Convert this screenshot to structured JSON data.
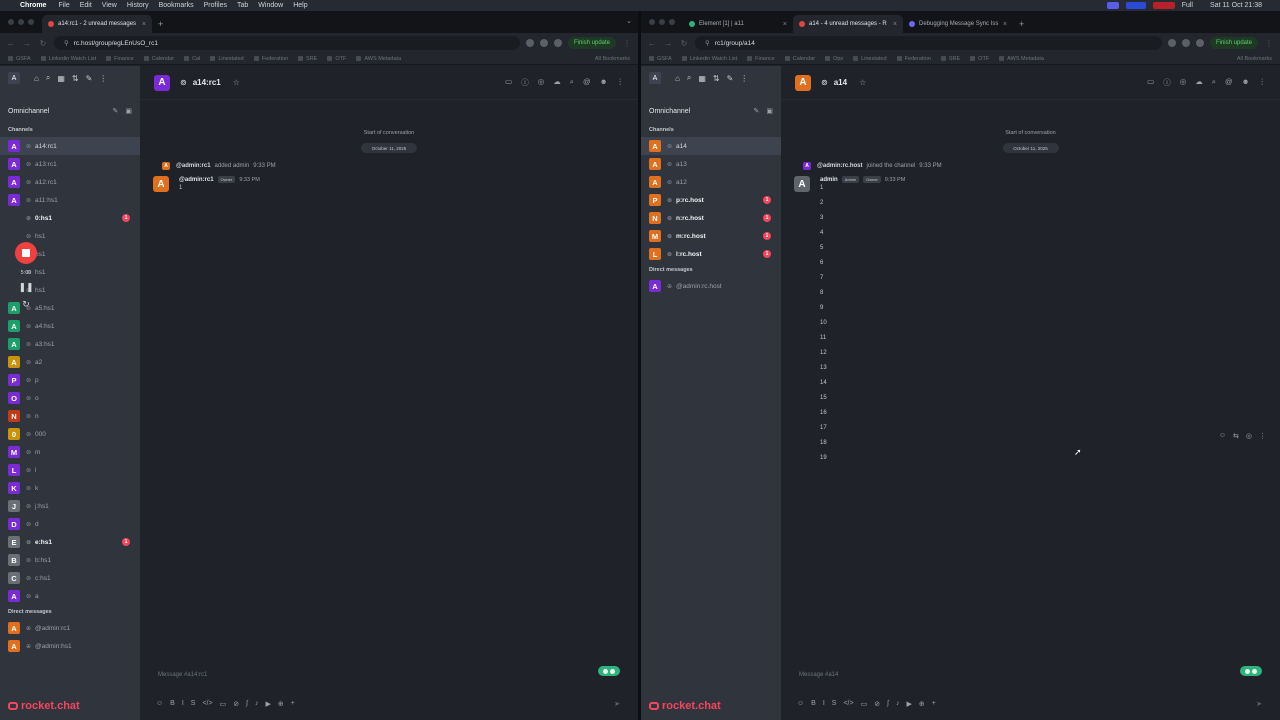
{
  "menubar": {
    "apple": "",
    "app": "Chrome",
    "items": [
      "File",
      "Edit",
      "View",
      "History",
      "Bookmarks",
      "Profiles",
      "Tab",
      "Window",
      "Help"
    ],
    "battery": "Full",
    "clock": "Sat 11 Oct  21:38"
  },
  "left": {
    "tabs": [
      {
        "label": "a14:rc1 - 2 unread messages",
        "active": true
      }
    ],
    "url": "rc.host/group/egLEnUsO_rc1",
    "update_label": "Finish update",
    "bookmarks": [
      "GSFA",
      "Linkedin Watch List",
      "Finance",
      "Calendar",
      "Cal",
      "Linestated",
      "Federation",
      "SRE",
      "OTF",
      "AWS Metadata"
    ],
    "all_bookmarks": "All Bookmarks",
    "sidebar": {
      "me_initial": "A",
      "omnichannel": "Omnichannel",
      "channels_header": "Channels",
      "dm_header": "Direct messages",
      "channels": [
        {
          "initial": "A",
          "color": "#7a2bd6",
          "name": "a14:rc1",
          "selected": true,
          "unread": false,
          "badge": ""
        },
        {
          "initial": "A",
          "color": "#7a2bd6",
          "name": "a13:rc1",
          "selected": false,
          "unread": false,
          "badge": ""
        },
        {
          "initial": "A",
          "color": "#7a2bd6",
          "name": "a12:rc1",
          "selected": false,
          "unread": false,
          "badge": ""
        },
        {
          "initial": "A",
          "color": "#7a2bd6",
          "name": "a11:hs1",
          "selected": false,
          "unread": false,
          "badge": ""
        },
        {
          "initial": "",
          "color": "#2f343d",
          "name": "0:hs1",
          "selected": false,
          "unread": true,
          "badge": "1"
        },
        {
          "initial": "",
          "color": "#2f343d",
          "name": "hs1",
          "selected": false,
          "unread": false,
          "badge": ""
        },
        {
          "initial": "",
          "color": "#2f343d",
          "name": "hs1",
          "selected": false,
          "unread": false,
          "badge": ""
        },
        {
          "initial": "",
          "color": "#2f343d",
          "name": "hs1",
          "selected": false,
          "unread": false,
          "badge": ""
        },
        {
          "initial": "",
          "color": "#2f343d",
          "name": "hs1",
          "selected": false,
          "unread": false,
          "badge": ""
        },
        {
          "initial": "A",
          "color": "#1d9f6c",
          "name": "a5:hs1",
          "selected": false,
          "unread": false,
          "badge": ""
        },
        {
          "initial": "A",
          "color": "#1d9f6c",
          "name": "a4:hs1",
          "selected": false,
          "unread": false,
          "badge": ""
        },
        {
          "initial": "A",
          "color": "#1d9f6c",
          "name": "a3:hs1",
          "selected": false,
          "unread": false,
          "badge": ""
        },
        {
          "initial": "A",
          "color": "#c9940b",
          "name": "a2",
          "selected": false,
          "unread": false,
          "badge": ""
        },
        {
          "initial": "P",
          "color": "#7a2bd6",
          "name": "p",
          "selected": false,
          "unread": false,
          "badge": ""
        },
        {
          "initial": "O",
          "color": "#7a2bd6",
          "name": "o",
          "selected": false,
          "unread": false,
          "badge": ""
        },
        {
          "initial": "N",
          "color": "#c23a16",
          "name": "n",
          "selected": false,
          "unread": false,
          "badge": ""
        },
        {
          "initial": "0",
          "color": "#c9940b",
          "name": "000",
          "selected": false,
          "unread": false,
          "badge": ""
        },
        {
          "initial": "M",
          "color": "#7a2bd6",
          "name": "m",
          "selected": false,
          "unread": false,
          "badge": ""
        },
        {
          "initial": "L",
          "color": "#7a2bd6",
          "name": "l",
          "selected": false,
          "unread": false,
          "badge": ""
        },
        {
          "initial": "K",
          "color": "#7a2bd6",
          "name": "k",
          "selected": false,
          "unread": false,
          "badge": ""
        },
        {
          "initial": "J",
          "color": "#6b6f76",
          "name": "j:hs1",
          "selected": false,
          "unread": false,
          "badge": ""
        },
        {
          "initial": "D",
          "color": "#7a2bd6",
          "name": "d",
          "selected": false,
          "unread": false,
          "badge": ""
        },
        {
          "initial": "E",
          "color": "#6b6f76",
          "name": "e:hs1",
          "selected": false,
          "unread": true,
          "badge": "1"
        },
        {
          "initial": "B",
          "color": "#6b6f76",
          "name": "b:hs1",
          "selected": false,
          "unread": false,
          "badge": ""
        },
        {
          "initial": "C",
          "color": "#6b6f76",
          "name": "c:hs1",
          "selected": false,
          "unread": false,
          "badge": ""
        },
        {
          "initial": "A",
          "color": "#7a2bd6",
          "name": "a",
          "selected": false,
          "unread": false,
          "badge": ""
        }
      ],
      "dms": [
        {
          "initial": "A",
          "color": "#e0701e",
          "name": "@admin:rc1"
        },
        {
          "initial": "A",
          "color": "#e0701e",
          "name": "@admin:hs1"
        }
      ],
      "logo": "rocket.chat"
    },
    "recorder": {
      "time": "5:00"
    },
    "room": {
      "initial": "A",
      "color": "#7a2bd6",
      "title": "a14:rc1",
      "start": "Start of conversation",
      "date": "October 11, 2025",
      "system": {
        "initial": "A",
        "color": "#e0701e",
        "user": "@admin:rc1",
        "text": "added admin",
        "time": "9:33 PM"
      },
      "messages": [
        {
          "initial": "A",
          "color": "#e0701e",
          "user": "@admin:rc1",
          "role": "Owner",
          "time": "9:33 PM",
          "lines": [
            "1"
          ]
        }
      ],
      "composer_placeholder": "Message #a14:rc1"
    }
  },
  "right": {
    "tabs": [
      {
        "label": "Element [1] | a11",
        "active": false,
        "fav": "g"
      },
      {
        "label": "a14 - 4 unread messages - R",
        "active": true,
        "fav": "r"
      },
      {
        "label": "Debugging Message Sync Iss",
        "active": false,
        "fav": "p"
      }
    ],
    "url": "rc1/group/a14",
    "update_label": "Finish update",
    "bookmarks": [
      "GSFA",
      "Linkedin Watch List",
      "Finance",
      "Calendar",
      "Ops",
      "Linestated",
      "Federation",
      "SRE",
      "OTF",
      "AWS Metadata"
    ],
    "all_bookmarks": "All Bookmarks",
    "sidebar": {
      "me_initial": "A",
      "omnichannel": "Omnichannel",
      "channels_header": "Channels",
      "dm_header": "Direct messages",
      "channels": [
        {
          "initial": "A",
          "color": "#e0701e",
          "name": "a14",
          "selected": true,
          "unread": false,
          "badge": ""
        },
        {
          "initial": "A",
          "color": "#e0701e",
          "name": "a13",
          "selected": false,
          "unread": false,
          "badge": ""
        },
        {
          "initial": "A",
          "color": "#e0701e",
          "name": "a12",
          "selected": false,
          "unread": false,
          "badge": ""
        },
        {
          "initial": "P",
          "color": "#e0701e",
          "name": "p:rc.host",
          "selected": false,
          "unread": true,
          "badge": "1"
        },
        {
          "initial": "N",
          "color": "#e0701e",
          "name": "n:rc.host",
          "selected": false,
          "unread": true,
          "badge": "1"
        },
        {
          "initial": "M",
          "color": "#e0701e",
          "name": "m:rc.host",
          "selected": false,
          "unread": true,
          "badge": "1"
        },
        {
          "initial": "L",
          "color": "#e0701e",
          "name": "l:rc.host",
          "selected": false,
          "unread": true,
          "badge": "1"
        }
      ],
      "dms": [
        {
          "initial": "A",
          "color": "#7a2bd6",
          "name": "@admin:rc.host"
        }
      ],
      "logo": "rocket.chat"
    },
    "room": {
      "initial": "A",
      "color": "#e0701e",
      "title": "a14",
      "start": "Start of conversation",
      "date": "October 11, 2025",
      "system": {
        "initial": "A",
        "color": "#7a2bd6",
        "user": "@admin:rc.host",
        "text": "joined the channel",
        "time": "9:33 PM"
      },
      "messages": [
        {
          "initial": "A",
          "color": "#5f636a",
          "user": "admin",
          "role": "Admin",
          "role2": "Owner",
          "time": "9:33 PM",
          "lines": [
            "1",
            "2",
            "3",
            "4",
            "5",
            "6",
            "7",
            "8",
            "9",
            "10",
            "11",
            "12",
            "13",
            "14",
            "15",
            "16",
            "17",
            "18",
            "19"
          ]
        }
      ],
      "composer_placeholder": "Message #a14"
    }
  },
  "icons": {
    "home": "⌂",
    "search": "⌕",
    "directory": "▦",
    "sort": "⇅",
    "edit": "✎",
    "kebab": "⋮",
    "star": "☆",
    "info": "ⓘ",
    "threads": "◎",
    "discussion": "☁",
    "mention": "@",
    "members": "☻",
    "call": "▭",
    "emoji": "☺",
    "bold": "B",
    "italic": "I",
    "strike": "S",
    "code": "</>",
    "codeblock": "▭",
    "link": "⊘",
    "formula": "∫",
    "mic": "♪",
    "video": "▶",
    "attach": "⊕",
    "plus": "+",
    "send": "➤"
  }
}
